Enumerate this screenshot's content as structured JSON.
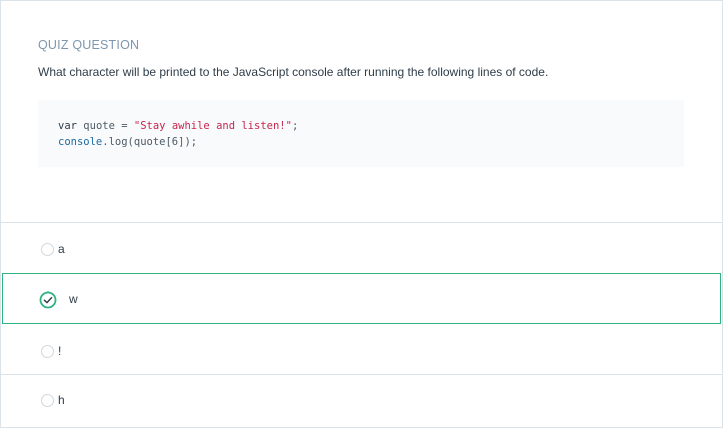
{
  "quiz": {
    "header": "QUIZ QUESTION",
    "question": "What character will be printed to the JavaScript console after running the following lines of code.",
    "code": {
      "line1": {
        "keyword": "var",
        "identifier": "quote",
        "operator": "=",
        "string": "\"Stay awhile and listen!\"",
        "end": ";"
      },
      "line2": {
        "object": "console",
        "rest": ".log(quote[6]);"
      }
    },
    "options": [
      {
        "label": "a",
        "selected": false
      },
      {
        "label": "w",
        "selected": true
      },
      {
        "label": "!",
        "selected": false
      },
      {
        "label": "h",
        "selected": false
      }
    ]
  },
  "colors": {
    "accent": "#2fb380",
    "header": "#7d97ad",
    "string": "#c7254e",
    "object": "#1c6aa0",
    "code_background": "#f9fafb"
  },
  "icons": {
    "selected_option": "check-circle-icon",
    "unselected_option": "radio-empty-icon"
  }
}
